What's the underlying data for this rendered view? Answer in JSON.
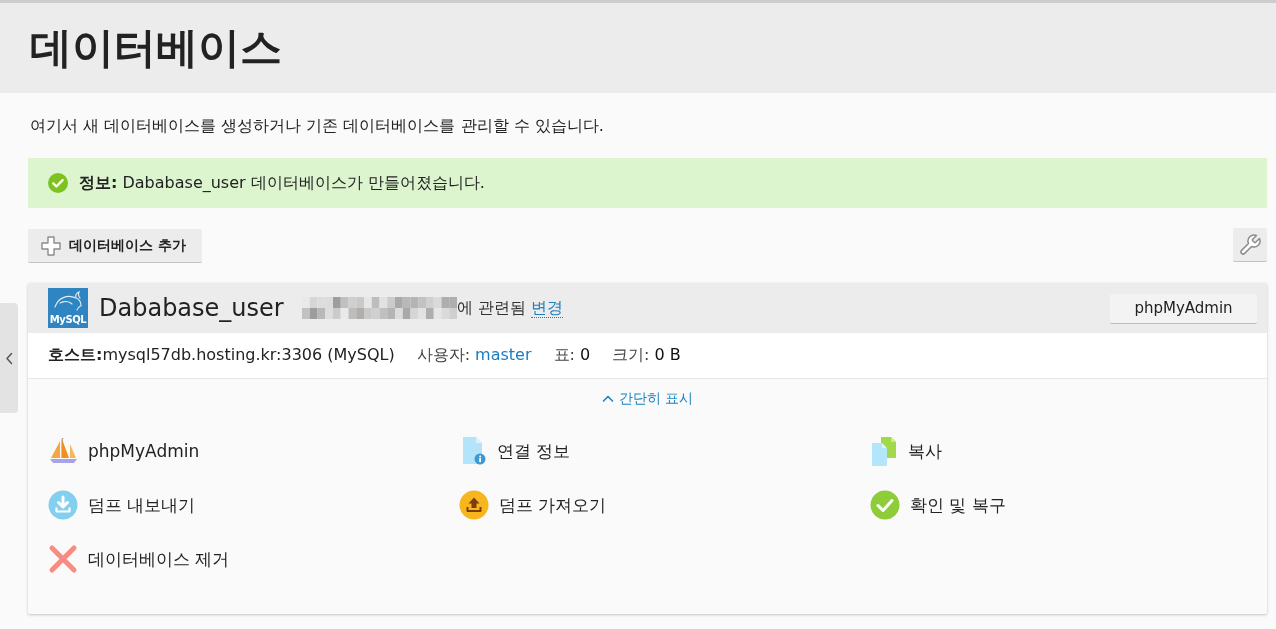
{
  "page_title": "데이터베이스",
  "description": "여기서 새 데이터베이스를 생성하거나 기존 데이터베이스를 관리할 수 있습니다.",
  "message": {
    "kind": "success",
    "text": "**정보:** Dababase_user 데이터베이스가 만들어졌습니다."
  },
  "toolbar": {
    "add_button": "데이터베이스 추가"
  },
  "database": {
    "logo_text": "MySQL",
    "name": "Dababase_user",
    "related_text": "에 관련됨",
    "change_link": "변경",
    "header_button": "phpMyAdmin",
    "details": [
      {
        "kind": "host",
        "label": "호스트:",
        "value": "mysql57db.hosting.kr:3306 (MySQL)"
      },
      {
        "kind": "link",
        "label": "사용자:",
        "value": "master"
      },
      {
        "kind": "value",
        "label": "표:",
        "value": "0"
      },
      {
        "kind": "value",
        "label": "크기:",
        "value": "0 B"
      }
    ],
    "collapse_link": "간단히 표시",
    "actions": [
      "phpMyAdmin",
      "연결 정보",
      "복사",
      "덤프 내보내기",
      "덤프 가져오기",
      "확인 및 복구",
      "데이터베이스 제거"
    ]
  }
}
